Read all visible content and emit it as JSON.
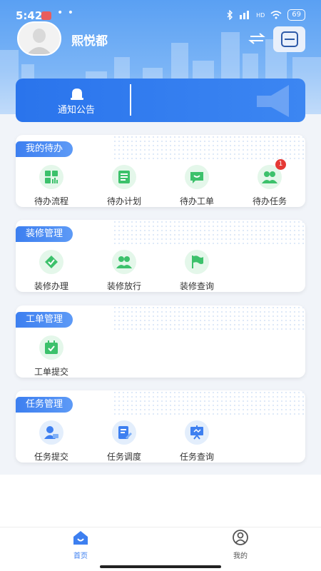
{
  "status_bar": {
    "time": "5:42",
    "dots": "• •",
    "network": "HD",
    "battery": "69"
  },
  "header": {
    "company_name": "熙悦都"
  },
  "notice": {
    "label": "通知公告"
  },
  "sections": [
    {
      "title": "我的待办",
      "items": [
        {
          "label": "待办流程",
          "icon": "apps-grid-icon"
        },
        {
          "label": "待办计划",
          "icon": "document-list-icon"
        },
        {
          "label": "待办工单",
          "icon": "chat-message-icon"
        },
        {
          "label": "待办任务",
          "icon": "people-group-icon",
          "badge": "1"
        }
      ]
    },
    {
      "title": "装修管理",
      "items": [
        {
          "label": "装修办理",
          "icon": "checkmark-icon"
        },
        {
          "label": "装修放行",
          "icon": "people-group-icon"
        },
        {
          "label": "装修查询",
          "icon": "flag-icon"
        }
      ]
    },
    {
      "title": "工单管理",
      "items": [
        {
          "label": "工单提交",
          "icon": "calendar-check-icon"
        }
      ]
    },
    {
      "title": "任务管理",
      "items": [
        {
          "label": "任务提交",
          "icon": "user-submit-icon"
        },
        {
          "label": "任务调度",
          "icon": "document-edit-icon"
        },
        {
          "label": "任务查询",
          "icon": "presentation-board-icon"
        }
      ]
    }
  ],
  "tabbar": {
    "home": "首页",
    "mine": "我的"
  },
  "colors": {
    "brand_blue": "#3d7ff0",
    "green": "#3cc16b",
    "badge_red": "#e53935"
  }
}
